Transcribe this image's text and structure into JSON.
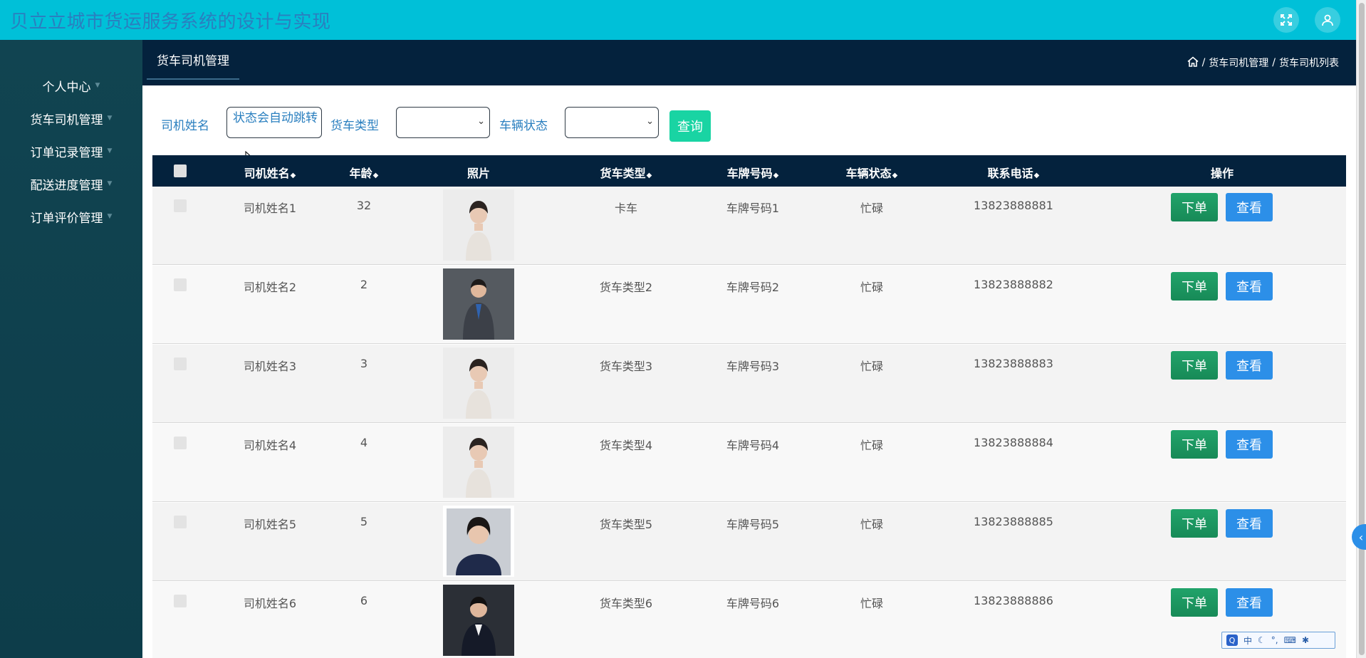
{
  "app": {
    "title": "贝立立城市货运服务系统的设计与实现"
  },
  "header": {
    "icons": [
      "fullscreen-icon",
      "user-icon"
    ]
  },
  "sidebar": {
    "items": [
      {
        "label": "个人中心"
      },
      {
        "label": "货车司机管理"
      },
      {
        "label": "订单记录管理"
      },
      {
        "label": "配送进度管理"
      },
      {
        "label": "订单评价管理"
      }
    ]
  },
  "tab": {
    "label": "货车司机管理"
  },
  "breadcrumb": {
    "items": [
      "货车司机管理",
      "货车司机列表"
    ],
    "separator": "/"
  },
  "search": {
    "driver_name_label": "司机姓名",
    "driver_name_value": "状态会自动跳转",
    "truck_type_label": "货车类型",
    "truck_type_value": "",
    "vehicle_status_label": "车辆状态",
    "vehicle_status_value": "",
    "query_button": "查询"
  },
  "table": {
    "columns": [
      "司机姓名",
      "年龄",
      "照片",
      "货车类型",
      "车牌号码",
      "车辆状态",
      "联系电话",
      "操作"
    ],
    "sort_icon": "sort-icon",
    "rows": [
      {
        "name": "司机姓名1",
        "age": "32",
        "photo": "female-portrait-light",
        "truck_type": "卡车",
        "plate": "车牌号码1",
        "status": "忙碌",
        "phone": "13823888881",
        "order": "下单",
        "view": "查看"
      },
      {
        "name": "司机姓名2",
        "age": "2",
        "photo": "male-portrait-suit",
        "truck_type": "货车类型2",
        "plate": "车牌号码2",
        "status": "忙碌",
        "phone": "13823888882",
        "order": "下单",
        "view": "查看"
      },
      {
        "name": "司机姓名3",
        "age": "3",
        "photo": "female-portrait-light",
        "truck_type": "货车类型3",
        "plate": "车牌号码3",
        "status": "忙碌",
        "phone": "13823888883",
        "order": "下单",
        "view": "查看"
      },
      {
        "name": "司机姓名4",
        "age": "4",
        "photo": "female-portrait-light",
        "truck_type": "货车类型4",
        "plate": "车牌号码4",
        "status": "忙碌",
        "phone": "13823888884",
        "order": "下单",
        "view": "查看"
      },
      {
        "name": "司机姓名5",
        "age": "5",
        "photo": "female-portrait-dark",
        "truck_type": "货车类型5",
        "plate": "车牌号码5",
        "status": "忙碌",
        "phone": "13823888885",
        "order": "下单",
        "view": "查看"
      },
      {
        "name": "司机姓名6",
        "age": "6",
        "photo": "male-portrait-dark",
        "truck_type": "货车类型6",
        "plate": "车牌号码6",
        "status": "忙碌",
        "phone": "13823888886",
        "order": "下单",
        "view": "查看"
      }
    ]
  },
  "ime": {
    "label": "中"
  },
  "colors": {
    "header": "#00c0d8",
    "sidebar": "#114451",
    "navy": "#04223d",
    "accent_title": "#2a7fbf",
    "order_button": "#1c9a62",
    "view_button": "#2c8fe8",
    "query_button": "#19d4a3"
  }
}
